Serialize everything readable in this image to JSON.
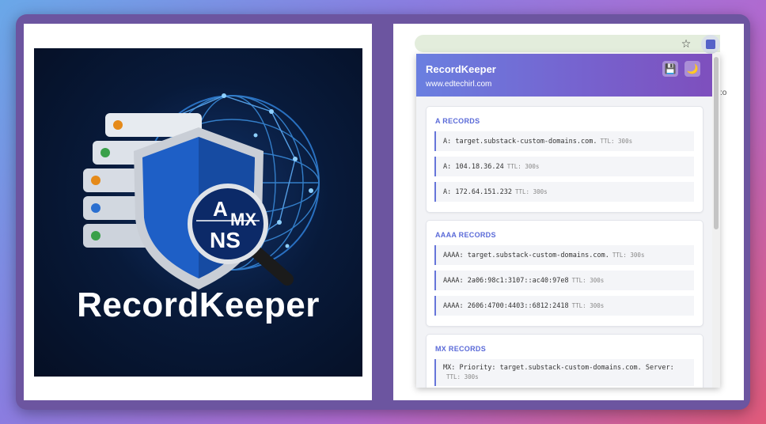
{
  "logo": {
    "brand_text": "RecordKeeper",
    "magnifier_labels": [
      "A",
      "MX",
      "NS"
    ]
  },
  "browser": {
    "star_icon": "star-icon",
    "extension_icon": "extension-icon"
  },
  "popup": {
    "title": "RecordKeeper",
    "domain": "www.edtechirl.com",
    "save_icon": "💾",
    "theme_icon": "🌙",
    "sections": [
      {
        "title": "A RECORDS",
        "records": [
          {
            "text": "A: target.substack-custom-domains.com.",
            "ttl": "TTL: 300s"
          },
          {
            "text": "A: 104.18.36.24",
            "ttl": "TTL: 300s"
          },
          {
            "text": "A: 172.64.151.232",
            "ttl": "TTL: 300s"
          }
        ]
      },
      {
        "title": "AAAA RECORDS",
        "records": [
          {
            "text": "AAAA: target.substack-custom-domains.com.",
            "ttl": "TTL: 300s"
          },
          {
            "text": "AAAA: 2a06:98c1:3107::ac40:97e8",
            "ttl": "TTL: 300s"
          },
          {
            "text": "AAAA: 2606:4700:4403::6812:2418",
            "ttl": "TTL: 300s"
          }
        ]
      },
      {
        "title": "MX RECORDS",
        "records": [
          {
            "text": "MX: Priority: target.substack-custom-domains.com. Server:",
            "ttl": "TTL: 300s"
          }
        ]
      }
    ]
  },
  "colors": {
    "accent": "#5a6ad8",
    "header_start": "#6a7fe0",
    "header_end": "#7e4fbd",
    "frame": "#6c55a0"
  }
}
